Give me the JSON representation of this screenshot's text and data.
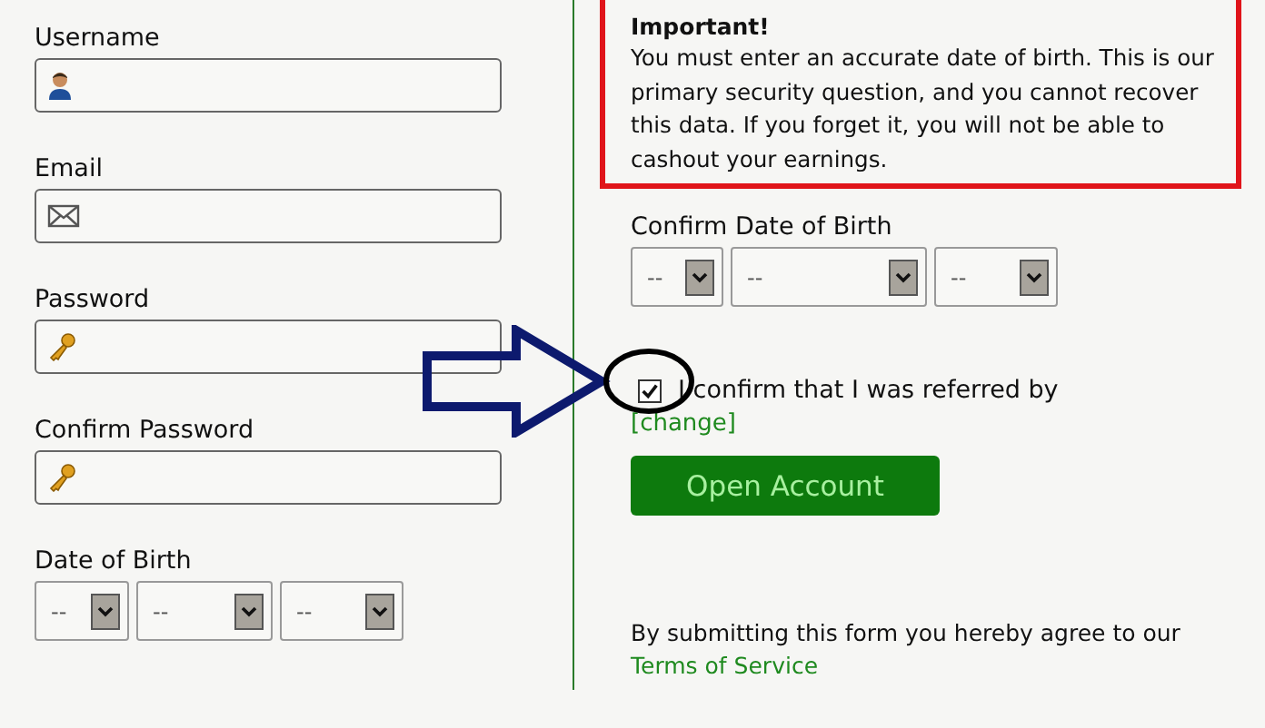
{
  "account_fields": [
    {
      "label": "Username",
      "kind": "user"
    },
    {
      "label": "Email",
      "kind": "mail"
    },
    {
      "label": "Password",
      "kind": "key"
    },
    {
      "label": "Confirm Password",
      "kind": "key"
    }
  ],
  "date_of_birth": {
    "label": "Date of Birth",
    "selects": [
      "--",
      "--",
      "--"
    ]
  },
  "notice": {
    "title": "Important!",
    "text": "You must enter an accurate date of birth. This is our primary security question, and you cannot recover this data. If you forget it, you will not be able to cashout your earnings."
  },
  "confirm_date_of_birth": {
    "label": "Confirm Date of Birth",
    "selects": [
      "--",
      "--",
      "--"
    ]
  },
  "referral": {
    "label": "I confirm that I was referred by",
    "checked": true,
    "link": "[change]"
  },
  "submit_button": "Open Account",
  "terms": {
    "text": "By submitting this form you hereby agree to our",
    "link": "Terms of Service"
  }
}
